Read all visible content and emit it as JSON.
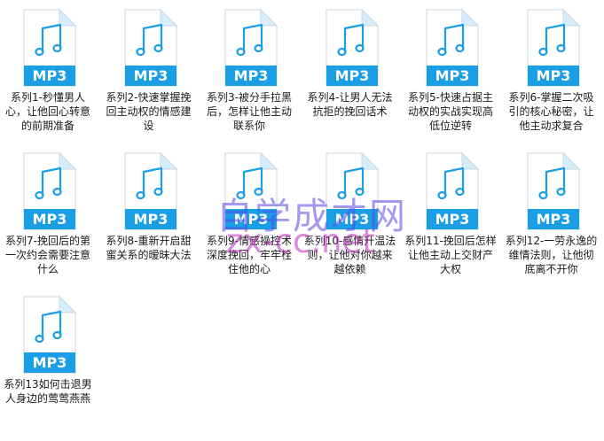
{
  "files": [
    {
      "name": "系列1-秒懂男人心，让他回心转意的前期准备",
      "type": "MP3"
    },
    {
      "name": "系列2-快速掌握挽回主动权的情感建设",
      "type": "MP3"
    },
    {
      "name": "系列3-被分手拉黑后，怎样让他主动联系你",
      "type": "MP3"
    },
    {
      "name": "系列4-让男人无法抗拒的挽回话术",
      "type": "MP3"
    },
    {
      "name": "系列5-快速占据主动权的实战实现高低位逆转",
      "type": "MP3"
    },
    {
      "name": "系列6-掌握二次吸引的核心秘密，让他主动求复合",
      "type": "MP3"
    },
    {
      "name": "系列7-挽回后的第一次约会需要注意什么",
      "type": "MP3"
    },
    {
      "name": "系列8-重新开启甜蜜关系的暧昧大法",
      "type": "MP3"
    },
    {
      "name": "系列9-情感操控术深度挽回，牢牢栓住他的心",
      "type": "MP3"
    },
    {
      "name": "系列10-感情升温法则，让他对你越来越依赖",
      "type": "MP3"
    },
    {
      "name": "系列11-挽回后怎样让他主动上交财产大权",
      "type": "MP3"
    },
    {
      "name": "系列12-一劳永逸的维情法则，让他彻底离不开你",
      "type": "MP3"
    },
    {
      "name": "系列13如何击退男人身边的莺莺燕燕",
      "type": "MP3"
    }
  ],
  "watermark": {
    "line1": "自学成才网",
    "line2": "zx-cc.net"
  },
  "colors": {
    "accent": "#1a9ee6",
    "paper": "#ffffff",
    "fold": "#d6eefb"
  }
}
